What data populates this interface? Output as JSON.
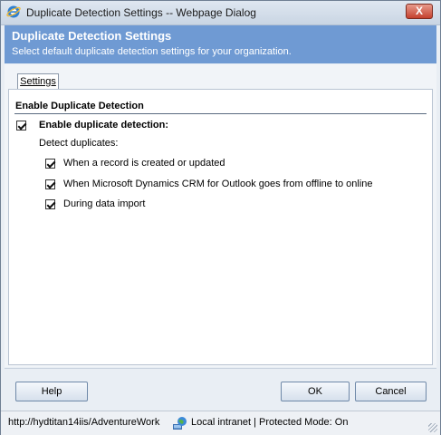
{
  "window": {
    "title": "Duplicate Detection Settings -- Webpage Dialog",
    "close_label": "X"
  },
  "header": {
    "title": "Duplicate Detection Settings",
    "subtitle": "Select default duplicate detection settings for your organization."
  },
  "tabs": [
    {
      "label": "Settings",
      "selected": true
    }
  ],
  "section": {
    "title": "Enable Duplicate Detection",
    "enable": {
      "label": "Enable duplicate detection:",
      "checked": true
    },
    "detect_label": "Detect duplicates:",
    "options": [
      {
        "label": "When a record is created or updated",
        "checked": true
      },
      {
        "label": "When Microsoft Dynamics CRM for Outlook goes from offline to online",
        "checked": true
      },
      {
        "label": "During data import",
        "checked": true
      }
    ]
  },
  "footer": {
    "help_label": "Help",
    "ok_label": "OK",
    "cancel_label": "Cancel"
  },
  "statusbar": {
    "url": "http://hydtitan14iis/AdventureWork",
    "zone": "Local intranet | Protected Mode: On"
  },
  "colors": {
    "header_bg": "#6f9ad3",
    "close_btn": "#c4412e"
  }
}
